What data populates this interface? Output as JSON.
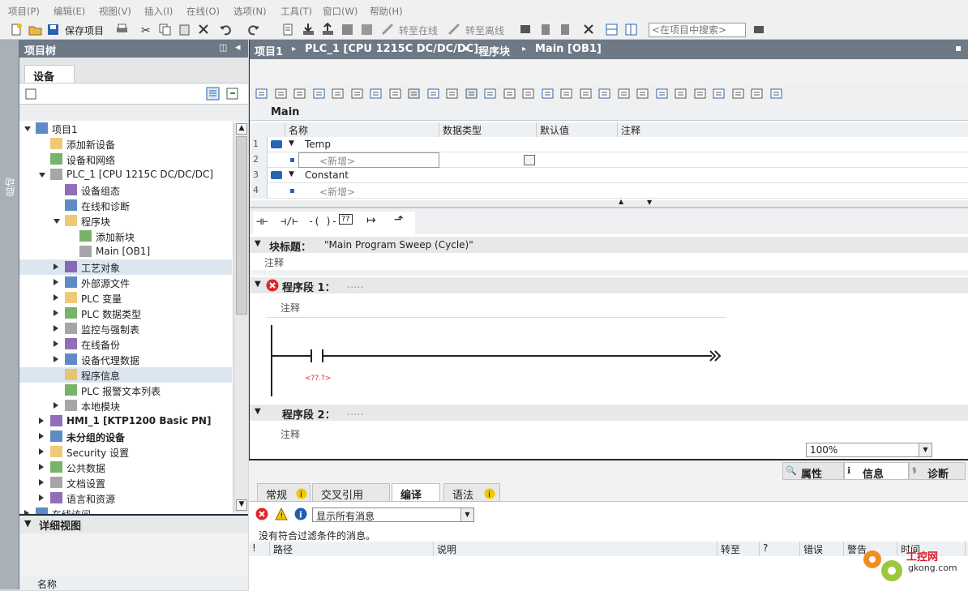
{
  "menu": [
    "项目(P)",
    "编辑(E)",
    "视图(V)",
    "插入(I)",
    "在线(O)",
    "选项(N)",
    "工具(T)",
    "窗口(W)",
    "帮助(H)"
  ],
  "toolbar": {
    "save_label": "保存项目",
    "go_online": "转至在线",
    "go_offline": "转至离线",
    "search_placeholder": "<在项目中搜索>"
  },
  "sidestrip": {
    "label": "启动"
  },
  "tree": {
    "title": "项目树",
    "tab": "设备",
    "items": [
      {
        "label": "项目1",
        "level": 0,
        "arrow": "down"
      },
      {
        "label": "添加新设备",
        "level": 1,
        "arrow": ""
      },
      {
        "label": "设备和网络",
        "level": 1,
        "arrow": ""
      },
      {
        "label": "PLC_1 [CPU 1215C DC/DC/DC]",
        "level": 1,
        "arrow": "down"
      },
      {
        "label": "设备组态",
        "level": 2,
        "arrow": ""
      },
      {
        "label": "在线和诊断",
        "level": 2,
        "arrow": ""
      },
      {
        "label": "程序块",
        "level": 2,
        "arrow": "down"
      },
      {
        "label": "添加新块",
        "level": 3,
        "arrow": ""
      },
      {
        "label": "Main [OB1]",
        "level": 3,
        "arrow": ""
      },
      {
        "label": "工艺对象",
        "level": 2,
        "arrow": "right"
      },
      {
        "label": "外部源文件",
        "level": 2,
        "arrow": "right"
      },
      {
        "label": "PLC 变量",
        "level": 2,
        "arrow": "right"
      },
      {
        "label": "PLC 数据类型",
        "level": 2,
        "arrow": "right"
      },
      {
        "label": "监控与强制表",
        "level": 2,
        "arrow": "right"
      },
      {
        "label": "在线备份",
        "level": 2,
        "arrow": "right"
      },
      {
        "label": "设备代理数据",
        "level": 2,
        "arrow": "right"
      },
      {
        "label": "程序信息",
        "level": 2,
        "arrow": ""
      },
      {
        "label": "PLC 报警文本列表",
        "level": 2,
        "arrow": ""
      },
      {
        "label": "本地模块",
        "level": 2,
        "arrow": "right"
      },
      {
        "label": "HMI_1 [KTP1200 Basic PN]",
        "level": 1,
        "arrow": "right"
      },
      {
        "label": "未分组的设备",
        "level": 1,
        "arrow": "right"
      },
      {
        "label": "Security 设置",
        "level": 1,
        "arrow": "right"
      },
      {
        "label": "公共数据",
        "level": 1,
        "arrow": "right"
      },
      {
        "label": "文档设置",
        "level": 1,
        "arrow": "right"
      },
      {
        "label": "语言和资源",
        "level": 1,
        "arrow": "right"
      },
      {
        "label": "在线访问",
        "level": 0,
        "arrow": "right"
      }
    ],
    "detail_title": "详细视图",
    "detail_col": "名称"
  },
  "editor": {
    "breadcrumb": [
      "项目1",
      "PLC_1 [CPU 1215C DC/DC/DC]",
      "程序块",
      "Main [OB1]"
    ],
    "block_name": "Main",
    "columns": [
      "名称",
      "数据类型",
      "默认值",
      "注释"
    ],
    "rows": [
      {
        "num": "1",
        "name": "Temp",
        "kind": "section"
      },
      {
        "num": "2",
        "name": "<新增>",
        "kind": "add"
      },
      {
        "num": "3",
        "name": "Constant",
        "kind": "section"
      },
      {
        "num": "4",
        "name": "<新增>",
        "kind": "add"
      }
    ],
    "block_title_label": "块标题：",
    "block_title_value": "\"Main Program Sweep (Cycle)\"",
    "comment": "注释",
    "network1": "程序段 1：",
    "network1_dots": ".....",
    "contact_addr": "<??.?>",
    "network2": "程序段 2：",
    "network2_dots": ".....",
    "zoom": "100%"
  },
  "inspector": {
    "panel_tabs": [
      "属性",
      "信息",
      "诊断"
    ],
    "tabs": [
      "常规",
      "交叉引用",
      "编译",
      "语法"
    ],
    "filter": "显示所有消息",
    "message": "没有符合过滤条件的消息。",
    "columns": [
      "!",
      "路径",
      "说明",
      "转至",
      "?",
      "错误",
      "警告",
      "时间"
    ]
  },
  "watermark": {
    "title": "工控网",
    "url": "gkong.com"
  },
  "colors": {
    "header": "#6e7986",
    "error": "#e0262a",
    "warning": "#f0c800",
    "info": "#1f5fb4"
  }
}
